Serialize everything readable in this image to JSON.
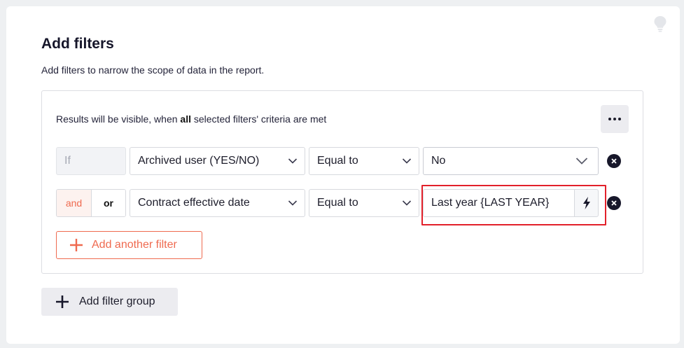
{
  "panel": {
    "title": "Add filters",
    "subtitle": "Add filters to narrow the scope of data in the report.",
    "criteria_prefix": "Results will be visible, when ",
    "criteria_emphasis": "all",
    "criteria_suffix": " selected filters' criteria are met"
  },
  "rows": [
    {
      "connector": "If",
      "field": "Archived user (YES/NO)",
      "operator": "Equal to",
      "value": "No"
    },
    {
      "connector_and": "and",
      "connector_or": "or",
      "connector_selected": "and",
      "field": "Contract effective date",
      "operator": "Equal to",
      "value": "Last year {LAST YEAR}"
    }
  ],
  "buttons": {
    "add_filter": "Add another filter",
    "add_group": "Add filter group"
  },
  "icons": {
    "hint": "lightbulb-icon",
    "more": "ellipsis-icon",
    "dynamic": "lightning-icon",
    "remove": "close-circle-icon",
    "add": "plus-icon",
    "dropdown": "chevron-down-icon"
  },
  "colors": {
    "accent": "#ef6a4f",
    "highlight": "#e2202a",
    "text": "#1d1d2b"
  }
}
